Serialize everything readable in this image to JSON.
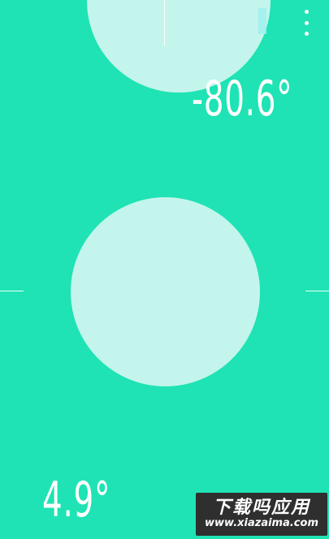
{
  "readings": {
    "top": "-80.6°",
    "bottom": "4.9°"
  },
  "watermark": {
    "title": "下载吗应用",
    "url": "www.xiazaima.com"
  },
  "icons": {
    "menu": "overflow-menu-icon"
  },
  "colors": {
    "background": "#1fe3b4",
    "bubble": "#c3f5ec",
    "indicator": "#9ff0f0",
    "text": "#ffffff"
  }
}
